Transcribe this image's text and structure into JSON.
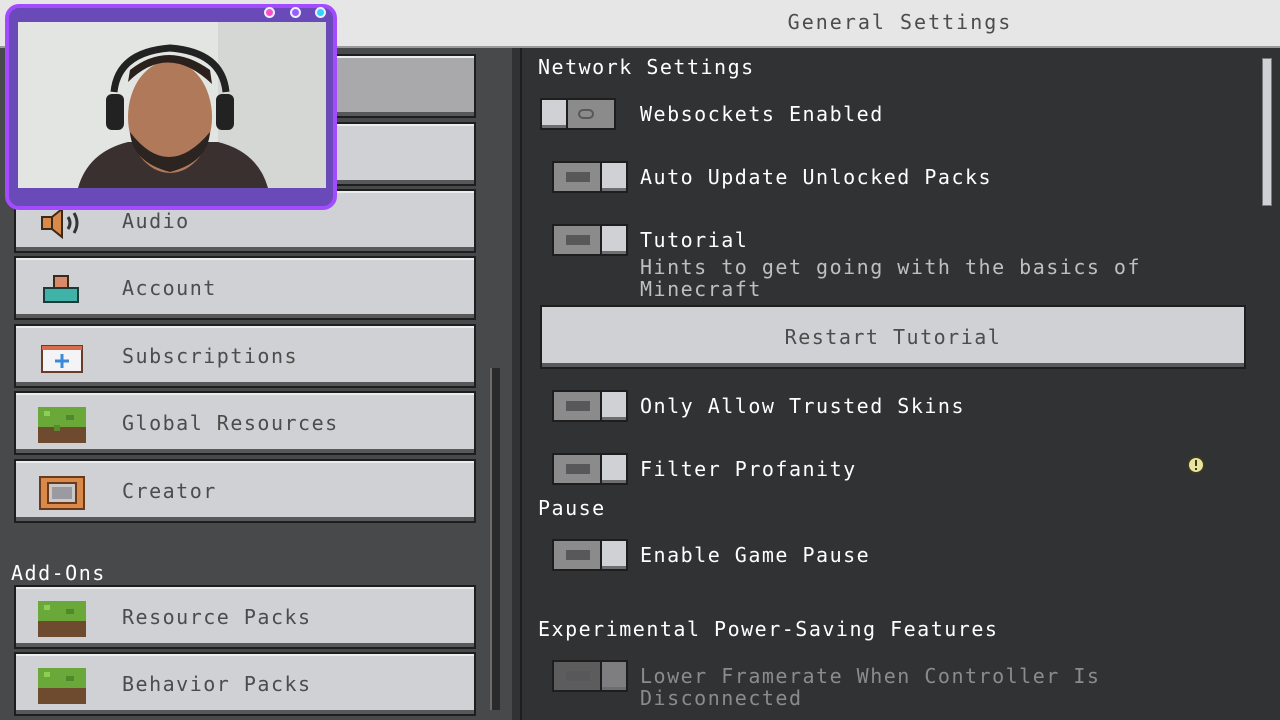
{
  "header": {
    "title": "General Settings"
  },
  "sidebar": {
    "items": [
      {
        "label": "",
        "icon": "unknown-icon"
      },
      {
        "label": "",
        "icon": "unknown-icon"
      },
      {
        "label": "Audio",
        "icon": "speaker-icon"
      },
      {
        "label": "Account",
        "icon": "account-icon"
      },
      {
        "label": "Subscriptions",
        "icon": "subscriptions-icon"
      },
      {
        "label": "Global Resources",
        "icon": "grass-block-icon"
      },
      {
        "label": "Creator",
        "icon": "command-block-icon"
      }
    ],
    "addons_heading": "Add-Ons",
    "addons": [
      {
        "label": "Resource Packs",
        "icon": "grass-block-icon"
      },
      {
        "label": "Behavior Packs",
        "icon": "grass-block-icon"
      }
    ]
  },
  "settings": {
    "network_heading": "Network Settings",
    "websockets": {
      "label": "Websockets Enabled",
      "on": false
    },
    "auto_update": {
      "label": "Auto Update Unlocked Packs",
      "on": true
    },
    "tutorial": {
      "label": "Tutorial",
      "description": "Hints to get going with the basics of Minecraft",
      "on": true
    },
    "restart_tutorial": "Restart Tutorial",
    "trusted_skins": {
      "label": "Only Allow Trusted Skins",
      "on": true
    },
    "filter_profanity": {
      "label": "Filter Profanity",
      "on": true,
      "info_icon": "info-icon"
    },
    "pause_heading": "Pause",
    "game_pause": {
      "label": "Enable Game Pause",
      "on": true
    },
    "power_heading": "Experimental Power-Saving Features",
    "lower_framerate": {
      "label": "Lower Framerate When Controller Is Disconnected",
      "on": true,
      "disabled": true
    }
  },
  "colors": {
    "panel_dark": "#313233",
    "panel_left": "#48494a",
    "button": "#d0d1d4",
    "webcam_frame": "#a34bff"
  },
  "overlay": {
    "type": "webcam",
    "dots": [
      "pink",
      "violet",
      "cyan"
    ]
  }
}
